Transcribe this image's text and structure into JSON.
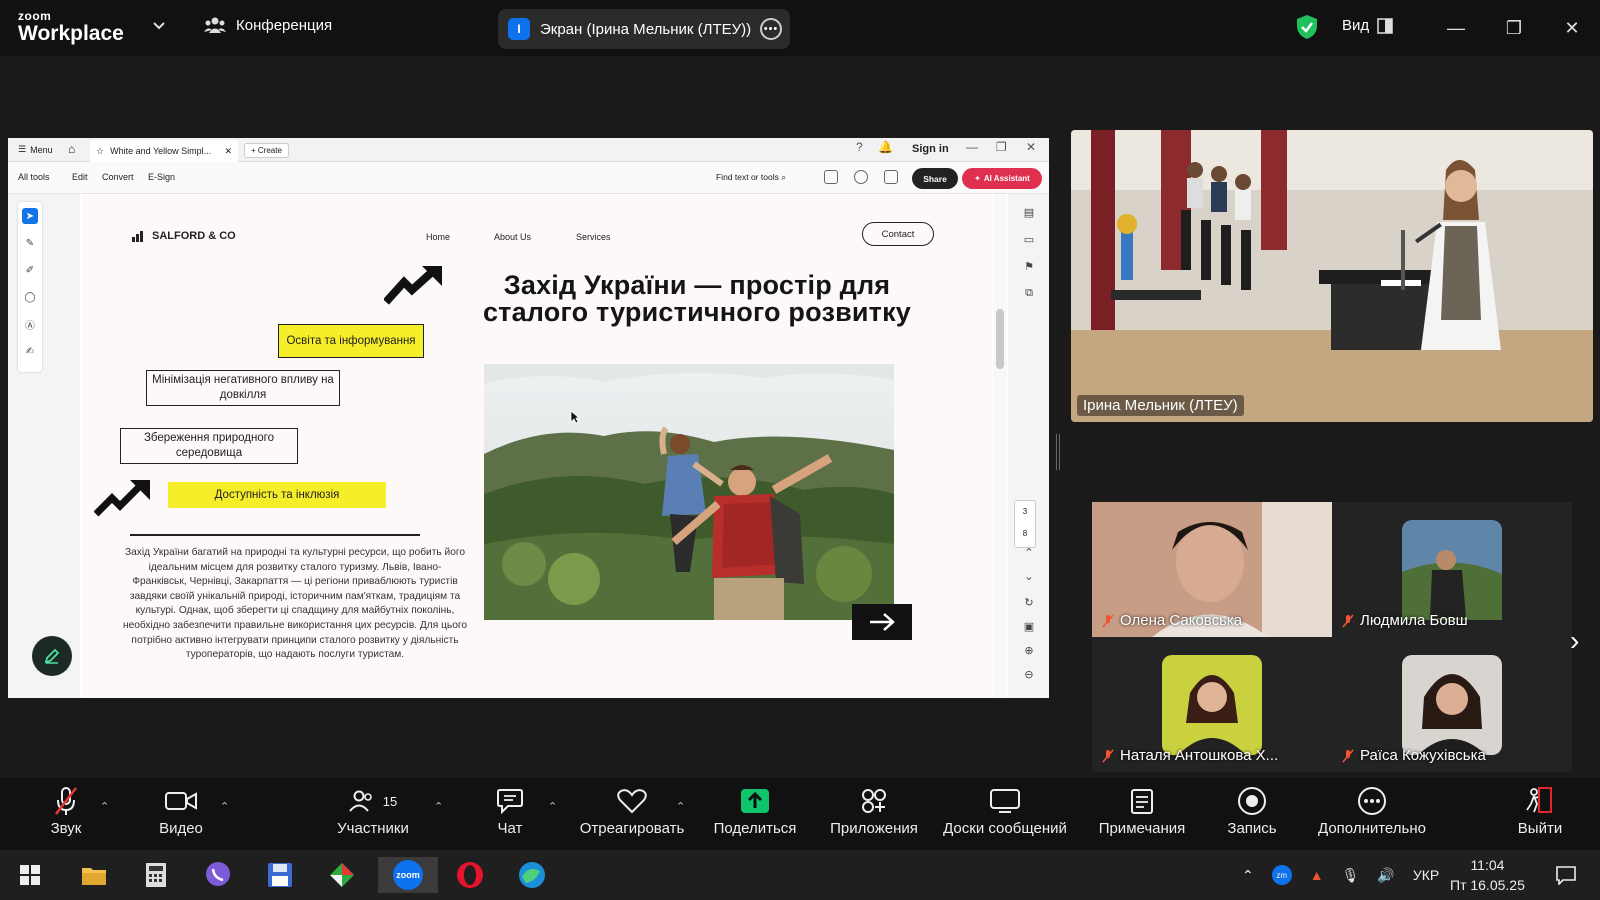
{
  "app": {
    "logo_top": "zoom",
    "logo_bottom": "Workplace",
    "meeting_label": "Конференция",
    "share_label": "Экран (Ірина Мельник  (ЛТЕУ))",
    "share_badge": "I",
    "view_label": "Вид"
  },
  "viewer": {
    "menu": "Menu",
    "tab_title": "White and Yellow Simpl...",
    "create": "Create",
    "sign_in": "Sign in",
    "menus": [
      "All tools",
      "Edit",
      "Convert",
      "E-Sign"
    ],
    "find": "Find text or tools",
    "share": "Share",
    "ai": "AI Assistant",
    "page_current": "3",
    "page_total": "8"
  },
  "doc": {
    "brand": "SALFORD & CO",
    "nav": [
      "Home",
      "About Us",
      "Services"
    ],
    "contact": "Contact",
    "headline": "Захід України — простір для сталого туристичного розвитку",
    "box1": "Освіта та інформування",
    "box2": "Мінімізація негативного впливу на довкілля",
    "box3": "Збереження природного середовища",
    "box4": "Доступність та інклюзія",
    "paragraph": "Захід України багатий на природні та культурні ресурси, що робить його ідеальним місцем для розвитку сталого туризму. Львів, Івано-Франківськ, Чернівці, Закарпаття — ці регіони приваблюють туристів завдяки своїй унікальній природі, історичним пам'яткам, традиціям та культурі. Однак, щоб зберегти ці спадщину для майбутніх поколінь, необхідно забезпечити правильне використання цих ресурсів. Для цього потрібно активно інтегрувати принципи сталого розвитку у діяльність туроператорів, що надають послуги туристам."
  },
  "speaker": {
    "name": "Ірина Мельник  (ЛТЕУ)"
  },
  "participants": [
    {
      "name": "Олена Саковська"
    },
    {
      "name": "Людмила Бовш"
    },
    {
      "name": "Наталя Антошкова Х..."
    },
    {
      "name": "Раїса Кожухівська"
    }
  ],
  "toolbar": {
    "audio": "Звук",
    "video": "Видео",
    "participants": "Участники",
    "participants_count": "15",
    "chat": "Чат",
    "react": "Отреагировать",
    "share": "Поделиться",
    "apps": "Приложения",
    "boards": "Доски сообщений",
    "notes": "Примечания",
    "record": "Запись",
    "more": "Дополнительно",
    "leave": "Выйти"
  },
  "taskbar": {
    "lang": "УКР",
    "time": "11:04",
    "date": "Пт 16.05.25",
    "zoom_label": "zoom"
  },
  "colors": {
    "accent_blue": "#0e72ed",
    "share_green": "#10c46b",
    "leave_red": "#e02828",
    "doc_yellow": "#f7ee2a",
    "ai_red": "#e0304f"
  }
}
